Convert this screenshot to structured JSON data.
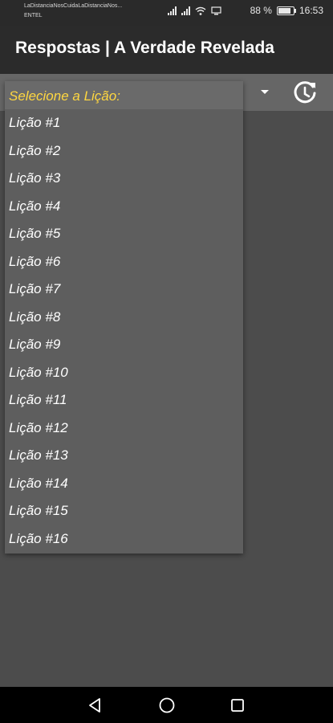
{
  "status_bar": {
    "carrier_line1": "LaDistanciaNosCuidaLaDistanciaNos...",
    "carrier_line2": "ENTEL",
    "battery_percent": "88 %",
    "time": "16:53"
  },
  "app_bar": {
    "title": "Respostas | A Verdade Revelada"
  },
  "dropdown": {
    "placeholder": "Selecione a Lição:",
    "items": [
      "Lição #1",
      "Lição #2",
      "Lição #3",
      "Lição #4",
      "Lição #5",
      "Lição #6",
      "Lição #7",
      "Lição #8",
      "Lição #9",
      "Lição #10",
      "Lição #11",
      "Lição #12",
      "Lição #13",
      "Lição #14",
      "Lição #15",
      "Lição #16"
    ]
  },
  "icons": {
    "dropdown_arrow": "caret-down-icon",
    "refresh": "refresh-clock-icon",
    "nav_back": "back-triangle-icon",
    "nav_home": "home-circle-icon",
    "nav_recents": "recents-square-icon"
  },
  "colors": {
    "placeholder_text": "#ffd740",
    "app_bar_bg": "#2b2b2b",
    "screen_bg": "#4c4c4c"
  }
}
